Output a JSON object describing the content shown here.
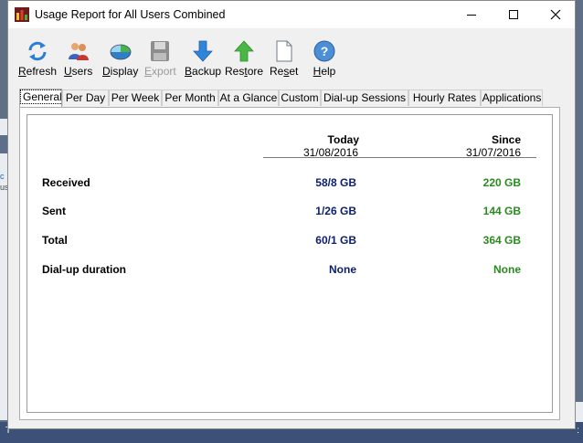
{
  "window": {
    "title": "Usage Report for All Users Combined"
  },
  "toolbar": {
    "items": [
      {
        "label": "Refresh",
        "access_key": "R",
        "icon": "refresh-icon",
        "enabled": true
      },
      {
        "label": "Users",
        "access_key": "U",
        "icon": "users-icon",
        "enabled": true
      },
      {
        "label": "Display",
        "access_key": "D",
        "icon": "display-icon",
        "enabled": true
      },
      {
        "label": "Export",
        "access_key": "E",
        "icon": "save-disk-icon",
        "enabled": false
      },
      {
        "label": "Backup",
        "access_key": "B",
        "icon": "arrow-down-icon",
        "enabled": true
      },
      {
        "label": "Restore",
        "access_key": "t",
        "icon": "arrow-up-icon",
        "enabled": true
      },
      {
        "label": "Reset",
        "access_key": "s",
        "icon": "blank-page-icon",
        "enabled": true
      },
      {
        "label": "Help",
        "access_key": "H",
        "icon": "help-icon",
        "enabled": true
      }
    ]
  },
  "tabs": [
    "General",
    "Per Day",
    "Per Week",
    "Per Month",
    "At a Glance",
    "Custom",
    "Dial-up Sessions",
    "Hourly Rates",
    "Applications"
  ],
  "active_tab": "General",
  "report": {
    "columns": [
      {
        "header": "Today",
        "date": "31/08/2016"
      },
      {
        "header": "Since",
        "date": "31/07/2016"
      }
    ],
    "rows": [
      {
        "label": "Received",
        "today": "58/8 GB",
        "since": "220 GB"
      },
      {
        "label": "Sent",
        "today": "1/26 GB",
        "since": "144 GB"
      },
      {
        "label": "Total",
        "today": "60/1 GB",
        "since": "364 GB"
      },
      {
        "label": "Dial-up duration",
        "today": "None",
        "since": "None"
      }
    ]
  },
  "colors": {
    "today_value": "#0b1e6e",
    "since_value": "#2a8a1f",
    "titlebar": "#ffffff"
  }
}
